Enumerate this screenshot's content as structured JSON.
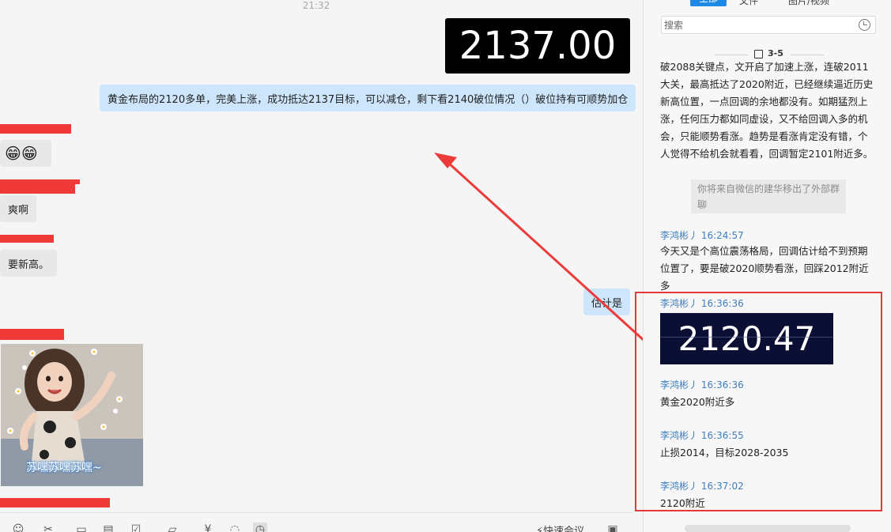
{
  "chat": {
    "timestamp": "21:32",
    "price_image_text": "2137.00",
    "self_messages": [
      "黄金布局的2120多单，完美上涨，成功抵达2137目标，可以减仓，剩下看2140破位情况（）破位持有可顺势加仓",
      "估计是"
    ],
    "other_messages": {
      "emoji": "😁😁",
      "shuang": "爽啊",
      "new_high": "要新高。"
    },
    "sticker_caption": "苏嘿苏嘿苏嘿~"
  },
  "toolbar": {
    "icons": [
      "emoji-icon",
      "scissors-icon",
      "image-icon",
      "document-icon",
      "checkbox-icon",
      "folder-icon",
      "yen-icon",
      "chat-icon",
      "history-icon",
      "window-icon"
    ],
    "quick_meeting_label": "快速会议"
  },
  "side_panel": {
    "tabs": {
      "all": "全部",
      "file": "文件",
      "image_video": "图片/视频"
    },
    "search_placeholder": "搜索",
    "date_label": "3-5",
    "intro_text": "破2088关键点，文开启了加速上涨，连破2011大关，最高抵达了2020附近，已经继续逼近历史新高位置，一点回调的余地都没有。如期猛烈上涨，任何压力都如同虚设，又不给回调入多的机会，只能顺势看涨。趋势是看涨肯定没有错，个人觉得不给机会就看看，回调暂定2101附近多。",
    "system_note": "你将来自微信的建华移出了外部群聊",
    "messages": [
      {
        "sender": "李鸿彬丿",
        "time": "16:24:57",
        "text": "今天又是个高位震荡格局，回调估计给不到预期位置了，要是破2020顺势看涨，回踩2012附近多"
      },
      {
        "sender": "李鸿彬丿",
        "time": "16:36:36",
        "image_text": "2120.47"
      },
      {
        "sender": "李鸿彬丿",
        "time": "16:36:36",
        "text": "黄金2020附近多"
      },
      {
        "sender": "李鸿彬丿",
        "time": "16:36:55",
        "text": "止损2014，目标2028-2035"
      },
      {
        "sender": "李鸿彬丿",
        "time": "16:37:02",
        "text": "2120附近"
      }
    ]
  },
  "colors": {
    "accent_blue": "#1e88e5",
    "self_bubble": "#cde6fb",
    "annotation_red": "#e23a3a",
    "sender_blue": "#3f7ec0"
  }
}
